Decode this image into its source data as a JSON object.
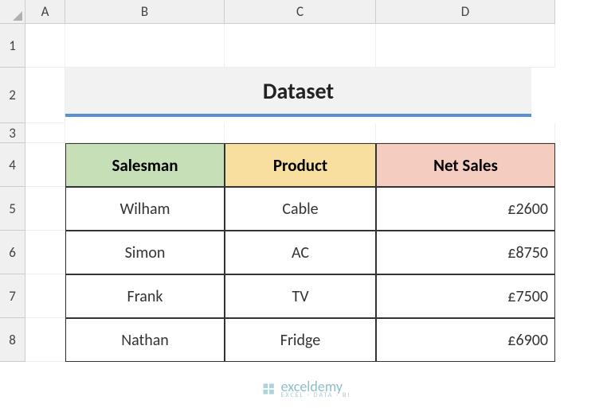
{
  "columns": [
    "A",
    "B",
    "C",
    "D"
  ],
  "rows": [
    "1",
    "2",
    "3",
    "4",
    "5",
    "6",
    "7",
    "8"
  ],
  "title": "Dataset",
  "headers": {
    "salesman": "Salesman",
    "product": "Product",
    "netsales": "Net Sales"
  },
  "data": [
    {
      "salesman": "Wilham",
      "product": "Cable",
      "netsales": "£2600"
    },
    {
      "salesman": "Simon",
      "product": "AC",
      "netsales": "£8750"
    },
    {
      "salesman": "Frank",
      "product": "TV",
      "netsales": "£7500"
    },
    {
      "salesman": "Nathan",
      "product": "Fridge",
      "netsales": "£6900"
    }
  ],
  "watermark": {
    "name": "exceldemy",
    "sub": "EXCEL · DATA · BI"
  }
}
